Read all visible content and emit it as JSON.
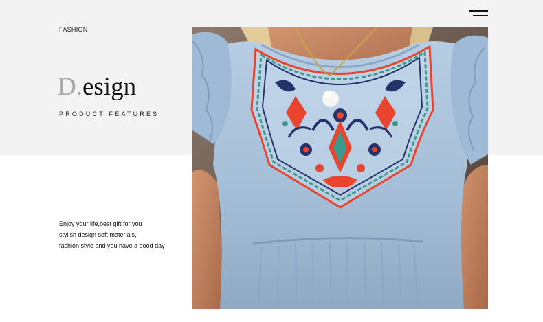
{
  "header": {
    "section_label": "FASHION",
    "menu_icon": "hamburger-menu-icon"
  },
  "hero": {
    "title_initial": "D.",
    "title_rest": "esign",
    "subtitle": "PRODUCT FEATURES"
  },
  "description": {
    "lines": [
      "Enjoy your life,best gift for you",
      "stylish design soft materials,",
      "fashion style and you have a good day"
    ]
  },
  "photo": {
    "subject": "light blue denim blouse with embroidered floral yoke"
  },
  "colors": {
    "band": "#f3f3f3",
    "denim": "#a9c3dc",
    "embroidery_red": "#e8442e",
    "embroidery_navy": "#25336b",
    "embroidery_teal": "#3b9a8c"
  }
}
